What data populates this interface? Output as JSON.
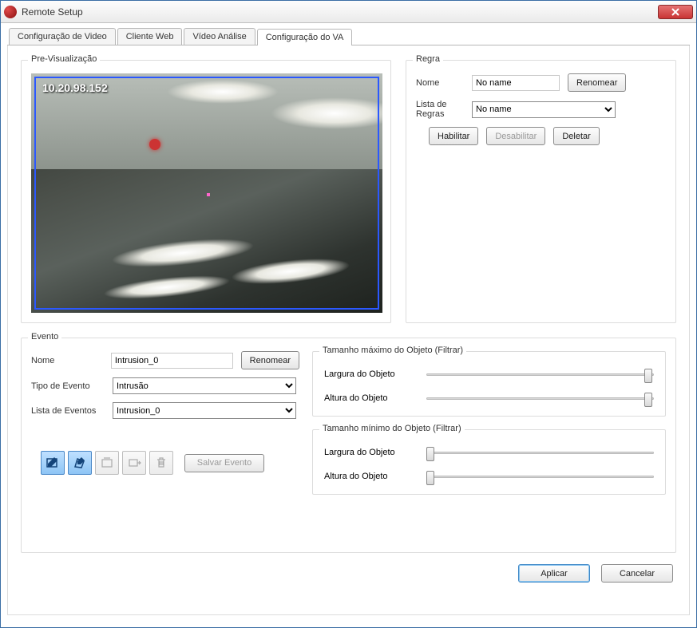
{
  "window": {
    "title": "Remote Setup"
  },
  "tabs": [
    "Configuração de Video",
    "Cliente Web",
    "Vídeo Análise",
    "Configuração do VA"
  ],
  "active_tab": 3,
  "preview": {
    "legend": "Pre-Visualização",
    "ip": "10.20.98.152"
  },
  "regra": {
    "legend": "Regra",
    "nome_label": "Nome",
    "nome_value": "No name",
    "renomear": "Renomear",
    "lista_label": "Lista de Regras",
    "lista_value": "No name",
    "habilitar": "Habilitar",
    "desabilitar": "Desabilitar",
    "deletar": "Deletar"
  },
  "evento": {
    "legend": "Evento",
    "nome_label": "Nome",
    "nome_value": "Intrusion_0",
    "renomear": "Renomear",
    "tipo_label": "Tipo de Evento",
    "tipo_value": "Intrusão",
    "lista_label": "Lista de Eventos",
    "lista_value": "Intrusion_0",
    "salvar": "Salvar Evento",
    "max": {
      "legend": "Tamanho máximo do Objeto (Filtrar)",
      "largura": "Largura do Objeto",
      "altura": "Altura do Objeto"
    },
    "min": {
      "legend": "Tamanho mínimo do Objeto (Filtrar)",
      "largura": "Largura do Objeto",
      "altura": "Altura do Objeto"
    }
  },
  "footer": {
    "aplicar": "Aplicar",
    "cancelar": "Cancelar"
  }
}
